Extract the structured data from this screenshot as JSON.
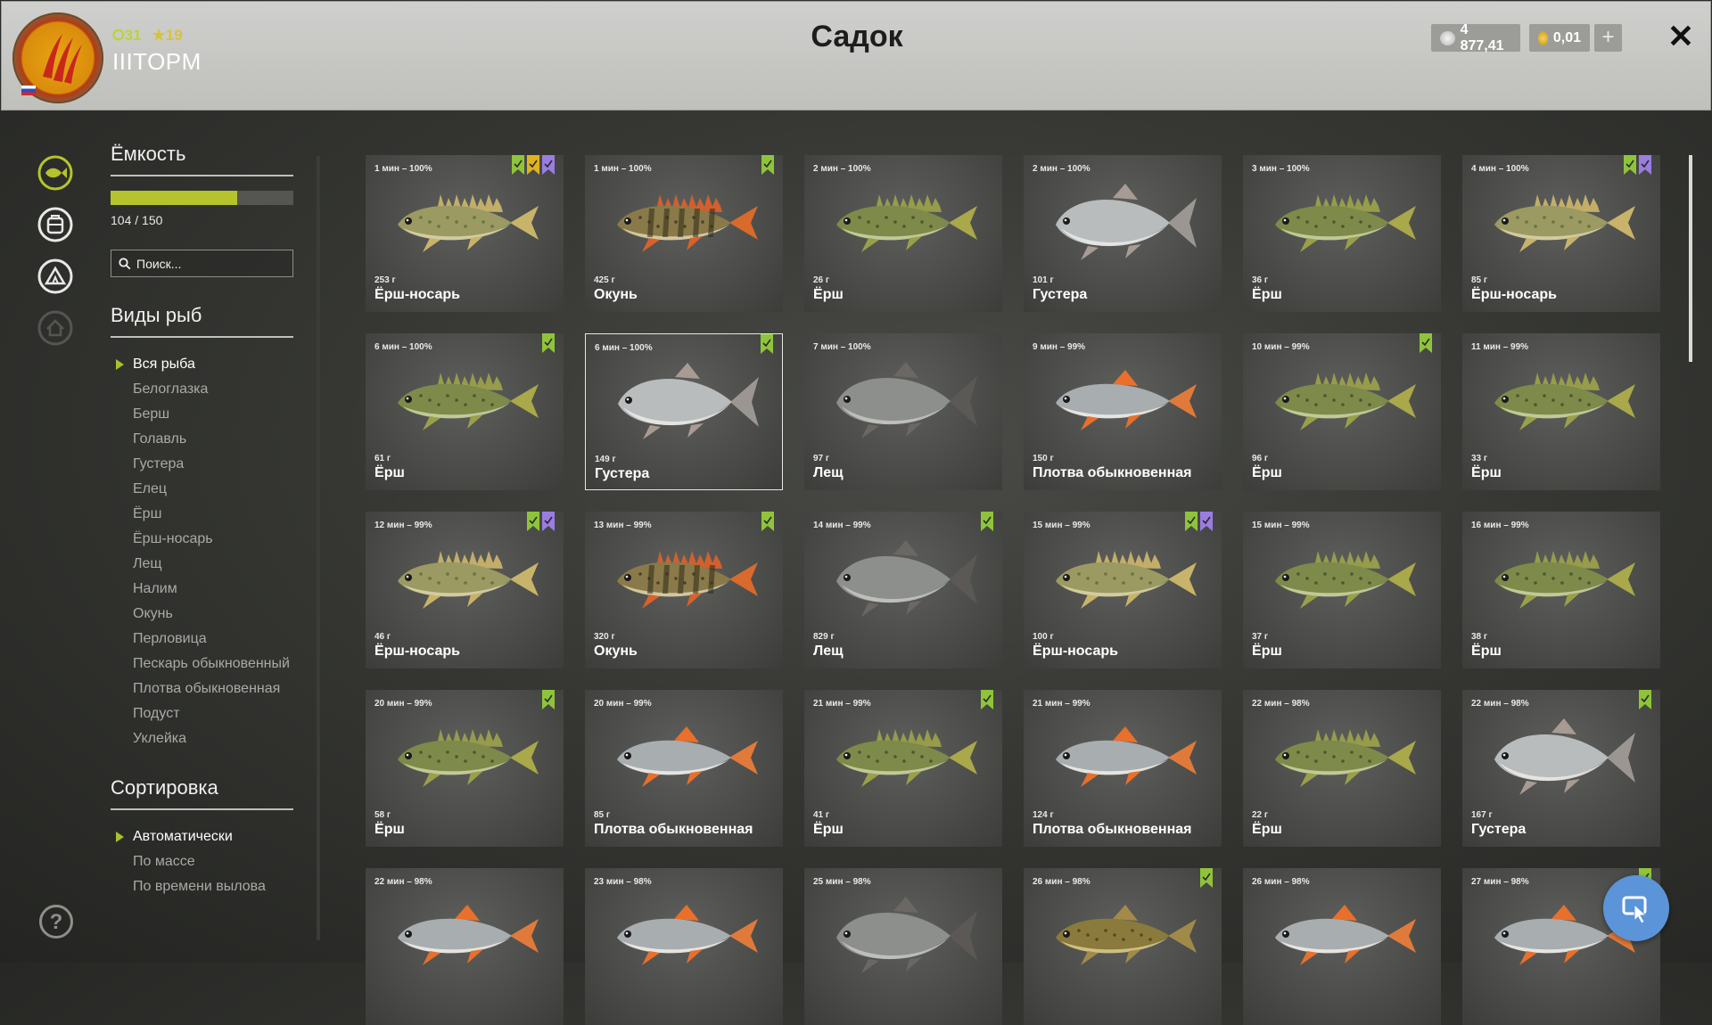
{
  "header": {
    "title": "Садок",
    "level": "31",
    "rating": "19",
    "username": "IIITOPM",
    "silver": "4 877,41",
    "gold": "0,01"
  },
  "panel": {
    "capacity_title": "Ёмкость",
    "capacity_text": "104 / 150",
    "capacity_fraction": 0.693,
    "search_placeholder": "Поиск...",
    "species_title": "Виды рыб",
    "species": [
      "Вся рыба",
      "Белоглазка",
      "Берш",
      "Голавль",
      "Густера",
      "Елец",
      "Ёрш",
      "Ёрш-носарь",
      "Лещ",
      "Налим",
      "Окунь",
      "Перловица",
      "Пескарь обыкновенный",
      "Плотва обыкновенная",
      "Подуст",
      "Уклейка"
    ],
    "sort_title": "Сортировка",
    "sort": [
      "Автоматически",
      "По массе",
      "По времени вылова"
    ]
  },
  "colors": {
    "accent": "#b5c42c",
    "tag_green": "#8fc43a",
    "tag_gold": "#e0b21e",
    "tag_purple": "#9a7de0"
  },
  "fish": [
    {
      "time": "1 мин – 100%",
      "weight": "253 г",
      "name": "Ёрш-носарь",
      "type": "nosar",
      "tags": [
        "green",
        "gold",
        "purple"
      ]
    },
    {
      "time": "1 мин – 100%",
      "weight": "425 г",
      "name": "Окунь",
      "type": "perch",
      "tags": [
        "green"
      ]
    },
    {
      "time": "2 мин – 100%",
      "weight": "26 г",
      "name": "Ёрш",
      "type": "ruffe",
      "tags": []
    },
    {
      "time": "2 мин – 100%",
      "weight": "101 г",
      "name": "Густера",
      "type": "bream_white",
      "tags": []
    },
    {
      "time": "3 мин – 100%",
      "weight": "36 г",
      "name": "Ёрш",
      "type": "ruffe",
      "tags": []
    },
    {
      "time": "4 мин – 100%",
      "weight": "85 г",
      "name": "Ёрш-носарь",
      "type": "nosar",
      "tags": [
        "green",
        "purple"
      ]
    },
    {
      "time": "6 мин – 100%",
      "weight": "61 г",
      "name": "Ёрш",
      "type": "ruffe",
      "tags": [
        "green"
      ]
    },
    {
      "time": "6 мин – 100%",
      "weight": "149 г",
      "name": "Густера",
      "type": "bream_white",
      "tags": [
        "green"
      ],
      "selected": true
    },
    {
      "time": "7 мин – 100%",
      "weight": "97 г",
      "name": "Лещ",
      "type": "bream",
      "tags": []
    },
    {
      "time": "9 мин – 99%",
      "weight": "150 г",
      "name": "Плотва обыкновенная",
      "type": "roach",
      "tags": []
    },
    {
      "time": "10 мин – 99%",
      "weight": "96 г",
      "name": "Ёрш",
      "type": "ruffe",
      "tags": [
        "green"
      ]
    },
    {
      "time": "11 мин – 99%",
      "weight": "33 г",
      "name": "Ёрш",
      "type": "ruffe",
      "tags": []
    },
    {
      "time": "12 мин – 99%",
      "weight": "46 г",
      "name": "Ёрш-носарь",
      "type": "nosar",
      "tags": [
        "green",
        "purple"
      ]
    },
    {
      "time": "13 мин – 99%",
      "weight": "320 г",
      "name": "Окунь",
      "type": "perch",
      "tags": [
        "green"
      ]
    },
    {
      "time": "14 мин – 99%",
      "weight": "829 г",
      "name": "Лещ",
      "type": "bream",
      "tags": [
        "green"
      ]
    },
    {
      "time": "15 мин – 99%",
      "weight": "100 г",
      "name": "Ёрш-носарь",
      "type": "nosar",
      "tags": [
        "green",
        "purple"
      ]
    },
    {
      "time": "15 мин – 99%",
      "weight": "37 г",
      "name": "Ёрш",
      "type": "ruffe",
      "tags": []
    },
    {
      "time": "16 мин – 99%",
      "weight": "38 г",
      "name": "Ёрш",
      "type": "ruffe",
      "tags": []
    },
    {
      "time": "20 мин – 99%",
      "weight": "58 г",
      "name": "Ёрш",
      "type": "ruffe",
      "tags": [
        "green"
      ]
    },
    {
      "time": "20 мин – 99%",
      "weight": "85 г",
      "name": "Плотва обыкновенная",
      "type": "roach",
      "tags": []
    },
    {
      "time": "21 мин – 99%",
      "weight": "41 г",
      "name": "Ёрш",
      "type": "ruffe",
      "tags": [
        "green"
      ]
    },
    {
      "time": "21 мин – 99%",
      "weight": "124 г",
      "name": "Плотва обыкновенная",
      "type": "roach",
      "tags": []
    },
    {
      "time": "22 мин – 98%",
      "weight": "22 г",
      "name": "Ёрш",
      "type": "ruffe",
      "tags": []
    },
    {
      "time": "22 мин – 98%",
      "weight": "167 г",
      "name": "Густера",
      "type": "bream_white",
      "tags": [
        "green"
      ]
    },
    {
      "time": "22 мин – 98%",
      "weight": "",
      "name": "",
      "type": "roach",
      "tags": []
    },
    {
      "time": "23 мин – 98%",
      "weight": "",
      "name": "",
      "type": "roach",
      "tags": []
    },
    {
      "time": "25 мин – 98%",
      "weight": "",
      "name": "",
      "type": "bream",
      "tags": []
    },
    {
      "time": "26 мин – 98%",
      "weight": "",
      "name": "",
      "type": "gudgeon",
      "tags": [
        "green"
      ]
    },
    {
      "time": "26 мин – 98%",
      "weight": "",
      "name": "",
      "type": "roach",
      "tags": []
    },
    {
      "time": "27 мин – 98%",
      "weight": "",
      "name": "",
      "type": "roach",
      "tags": [
        "green"
      ]
    }
  ]
}
